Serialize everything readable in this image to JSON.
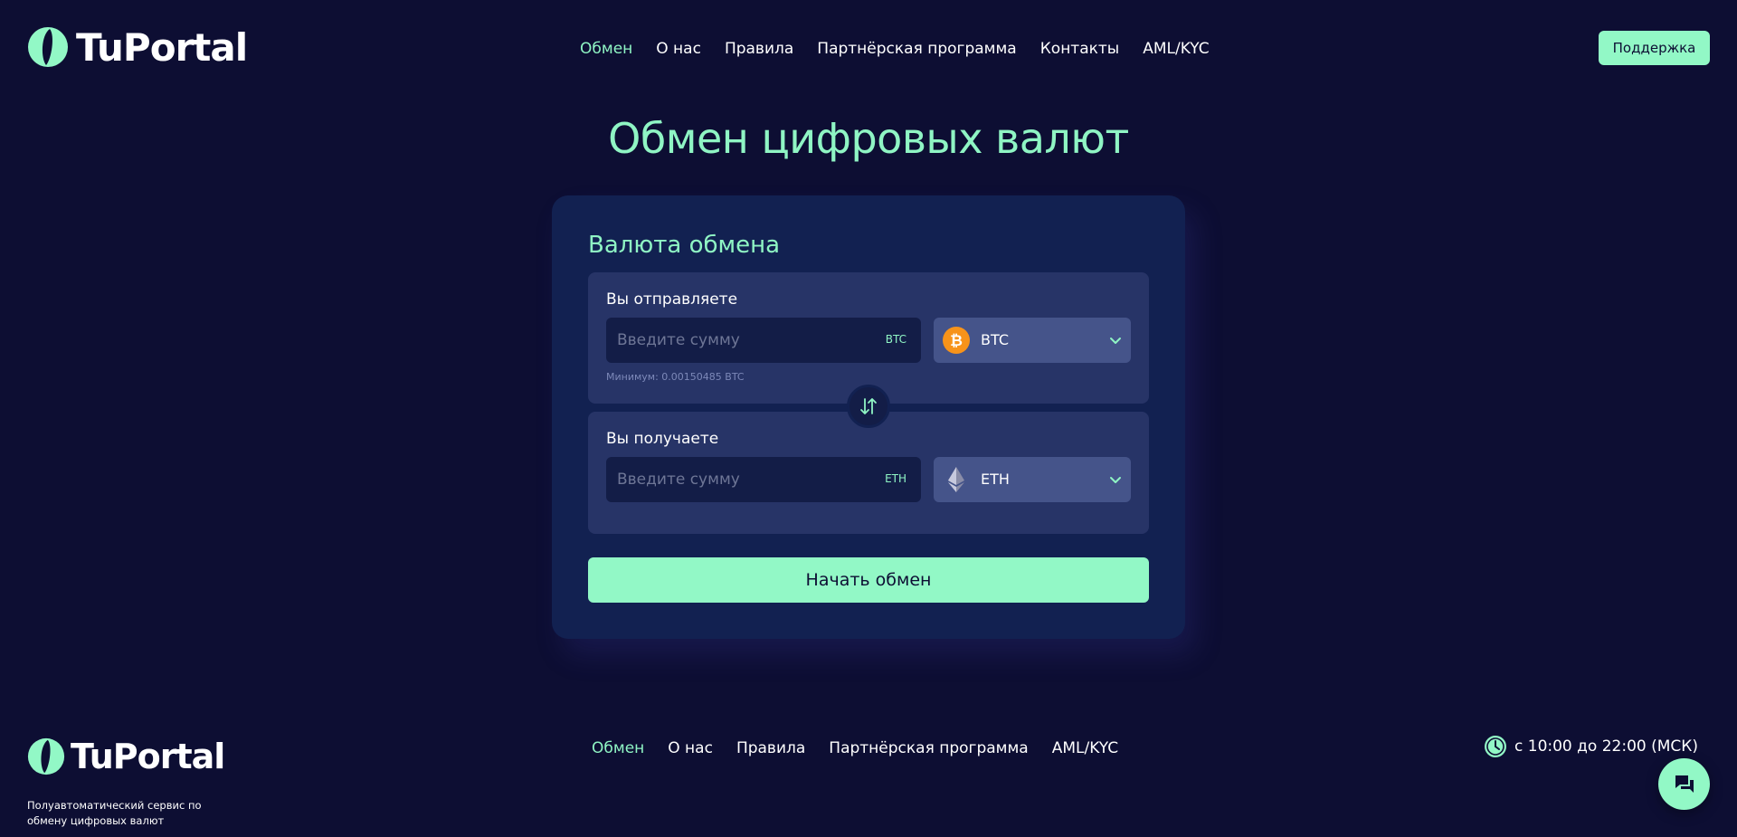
{
  "brand": {
    "name": "TuPortal",
    "accent": "#92f8c6",
    "background": "#0d0e33"
  },
  "header": {
    "nav": [
      "Обмен",
      "О нас",
      "Правила",
      "Партнёрская программа",
      "Контакты",
      "AML/KYC"
    ],
    "support_label": "Поддержка"
  },
  "main": {
    "title": "Обмен цифровых валют",
    "card": {
      "title": "Валюта обмена",
      "send": {
        "label": "Вы отправляете",
        "placeholder": "Введите сумму",
        "unit": "BTC",
        "currency": "BTC",
        "currency_icon": "bitcoin-icon",
        "min_note": "Минимум: 0.00150485 BTC"
      },
      "receive": {
        "label": "Вы получаете",
        "placeholder": "Введите сумму",
        "unit": "ETH",
        "currency": "ETH",
        "currency_icon": "ethereum-icon"
      },
      "swap_icon": "swap-arrows-icon",
      "start_label": "Начать обмен"
    }
  },
  "footer": {
    "nav": [
      "Обмен",
      "О нас",
      "Правила",
      "Партнёрская программа",
      "AML/KYC"
    ],
    "tagline_line1": "Полуавтоматический сервис по",
    "tagline_line2": "обмену цифровых валют",
    "hours": "с 10:00 до 22:00 (МСК)",
    "clock_icon": "clock-icon",
    "chat_icon": "chat-icon"
  }
}
